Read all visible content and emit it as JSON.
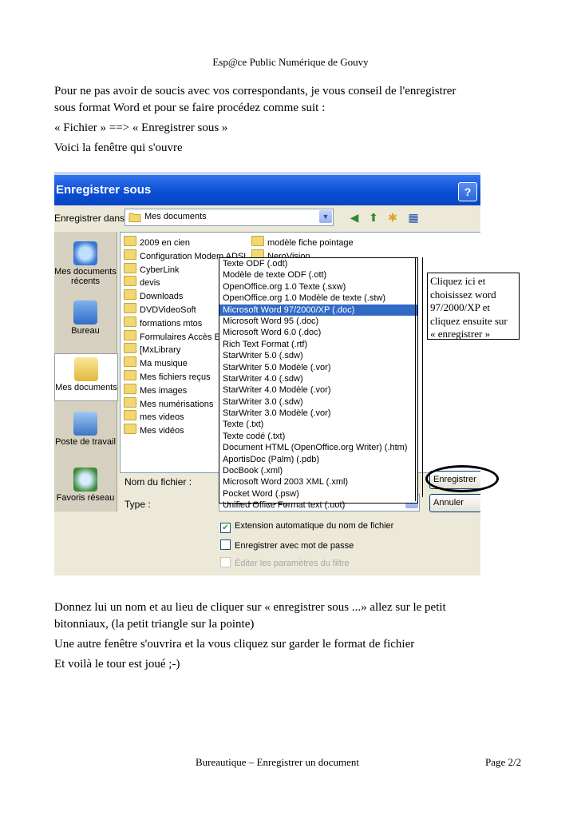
{
  "header": {
    "text": "Esp@ce Public Numérique de Gouvy"
  },
  "intro": {
    "line1": "Pour ne pas avoir de soucis avec vos correspondants, je vous conseil de l'enregistrer",
    "line2": "sous format Word et pour se faire procédez comme suit :",
    "line3": "« Fichier » ==> « Enregistrer sous »",
    "line4": "Voici la fenêtre qui s'ouvre"
  },
  "dialog": {
    "title": "Enregistrer sous",
    "help_label": "?",
    "save_in_label": "Enregistrer dans :",
    "save_in_value": "Mes documents",
    "places": [
      "Mes documents récents",
      "Bureau",
      "Mes documents",
      "Poste de travail",
      "Favoris réseau"
    ],
    "files_col1": [
      "2009 en cien",
      "Configuration Modem ADSL",
      "CyberLink",
      "devis",
      "Downloads",
      "DVDVideoSoft",
      "formations mtos",
      "Formulaires Accès EP",
      "[MxLibrary",
      "Ma musique",
      "Mes fichiers reçus",
      "Mes images",
      "Mes numérisations",
      "mes videos",
      "Mes vidéos"
    ],
    "files_col2": [
      "modèle fiche pointage",
      "NeroVision"
    ],
    "file_types": [
      "Texte ODF (.odt)",
      "Modèle de texte ODF (.ott)",
      "OpenOffice.org 1.0 Texte (.sxw)",
      "OpenOffice.org 1.0 Modèle de texte (.stw)",
      "Microsoft Word 97/2000/XP (.doc)",
      "Microsoft Word 95 (.doc)",
      "Microsoft Word 6.0 (.doc)",
      "Rich Text Format (.rtf)",
      "StarWriter 5.0 (.sdw)",
      "StarWriter 5.0 Modèle (.vor)",
      "StarWriter 4.0 (.sdw)",
      "StarWriter 4.0 Modèle (.vor)",
      "StarWriter 3.0 (.sdw)",
      "StarWriter 3.0 Modèle (.vor)",
      "Texte (.txt)",
      "Texte codé (.txt)",
      "Document HTML (OpenOffice.org Writer) (.htm)",
      "AportisDoc (Palm) (.pdb)",
      "DocBook (.xml)",
      "Microsoft Word 2003 XML (.xml)",
      "Pocket Word (.psw)",
      "Unified Office Format text (.uot)"
    ],
    "highlighted_type_index": 4,
    "filename_label": "Nom du fichier :",
    "type_label": "Type :",
    "type_value": "Texte ODF (.odt)",
    "save_button": "Enregistrer",
    "cancel_button": "Annuler",
    "checkbox_auto_ext": "Extension automatique du nom de fichier",
    "checkbox_password": "Enregistrer avec mot de passe",
    "checkbox_filter": "Éditer les paramètres du filtre"
  },
  "callout": {
    "line1": "Cliquez ici et",
    "line2": "choisissez word",
    "line3": "97/2000/XP et",
    "line4": "cliquez ensuite sur",
    "line5": "« enregistrer »"
  },
  "outro": {
    "line1": "Donnez lui un nom et au lieu de cliquer sur « enregistrer sous ...» allez sur le petit",
    "line2": "bitonniaux, (la petit triangle sur la pointe)",
    "line3": "Une autre fenêtre s'ouvrira et la vous cliquez sur garder le format de fichier",
    "line4": "Et voilà le tour est joué ;-)"
  },
  "footer": {
    "center": "Bureautique – Enregistrer un document",
    "page": "Page 2/2"
  },
  "colors": {
    "selection": "#316ac5",
    "titlebar": "#0a4fd6"
  }
}
